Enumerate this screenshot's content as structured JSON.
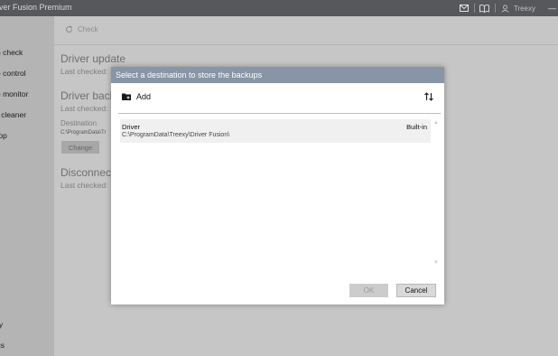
{
  "app": {
    "title": "iver Fusion Premium",
    "user": "Treexy",
    "icons": [
      "mail-icon",
      "book-icon",
      "user-icon",
      "minimize-icon"
    ]
  },
  "sidebar": {
    "items": [
      {
        "label": "h check"
      },
      {
        "label": "e control"
      },
      {
        "label": "e monitor"
      },
      {
        "label": "r cleaner"
      },
      {
        "label": "top"
      },
      {
        "label": "ry"
      },
      {
        "label": "gs"
      }
    ]
  },
  "main": {
    "check_label": "Check",
    "sections": [
      {
        "title": "Driver update",
        "subtitle": "Last checked: "
      },
      {
        "title": "Driver back",
        "subtitle": "Last checked: "
      },
      {
        "title": "Disconnect",
        "subtitle": "Last checked: "
      }
    ],
    "destination_label": "Destination",
    "destination_path": "C:\\ProgramData\\Tr",
    "change_label": "Change"
  },
  "dialog": {
    "title": "Select a destination to store the backups",
    "add_label": "Add",
    "header_color": "#8795a6",
    "rows": [
      {
        "name": "Driver",
        "path": "C:\\ProgramData\\Treexy\\Driver Fusion\\",
        "type": "Built-in"
      }
    ],
    "ok_label": "OK",
    "cancel_label": "Cancel"
  }
}
